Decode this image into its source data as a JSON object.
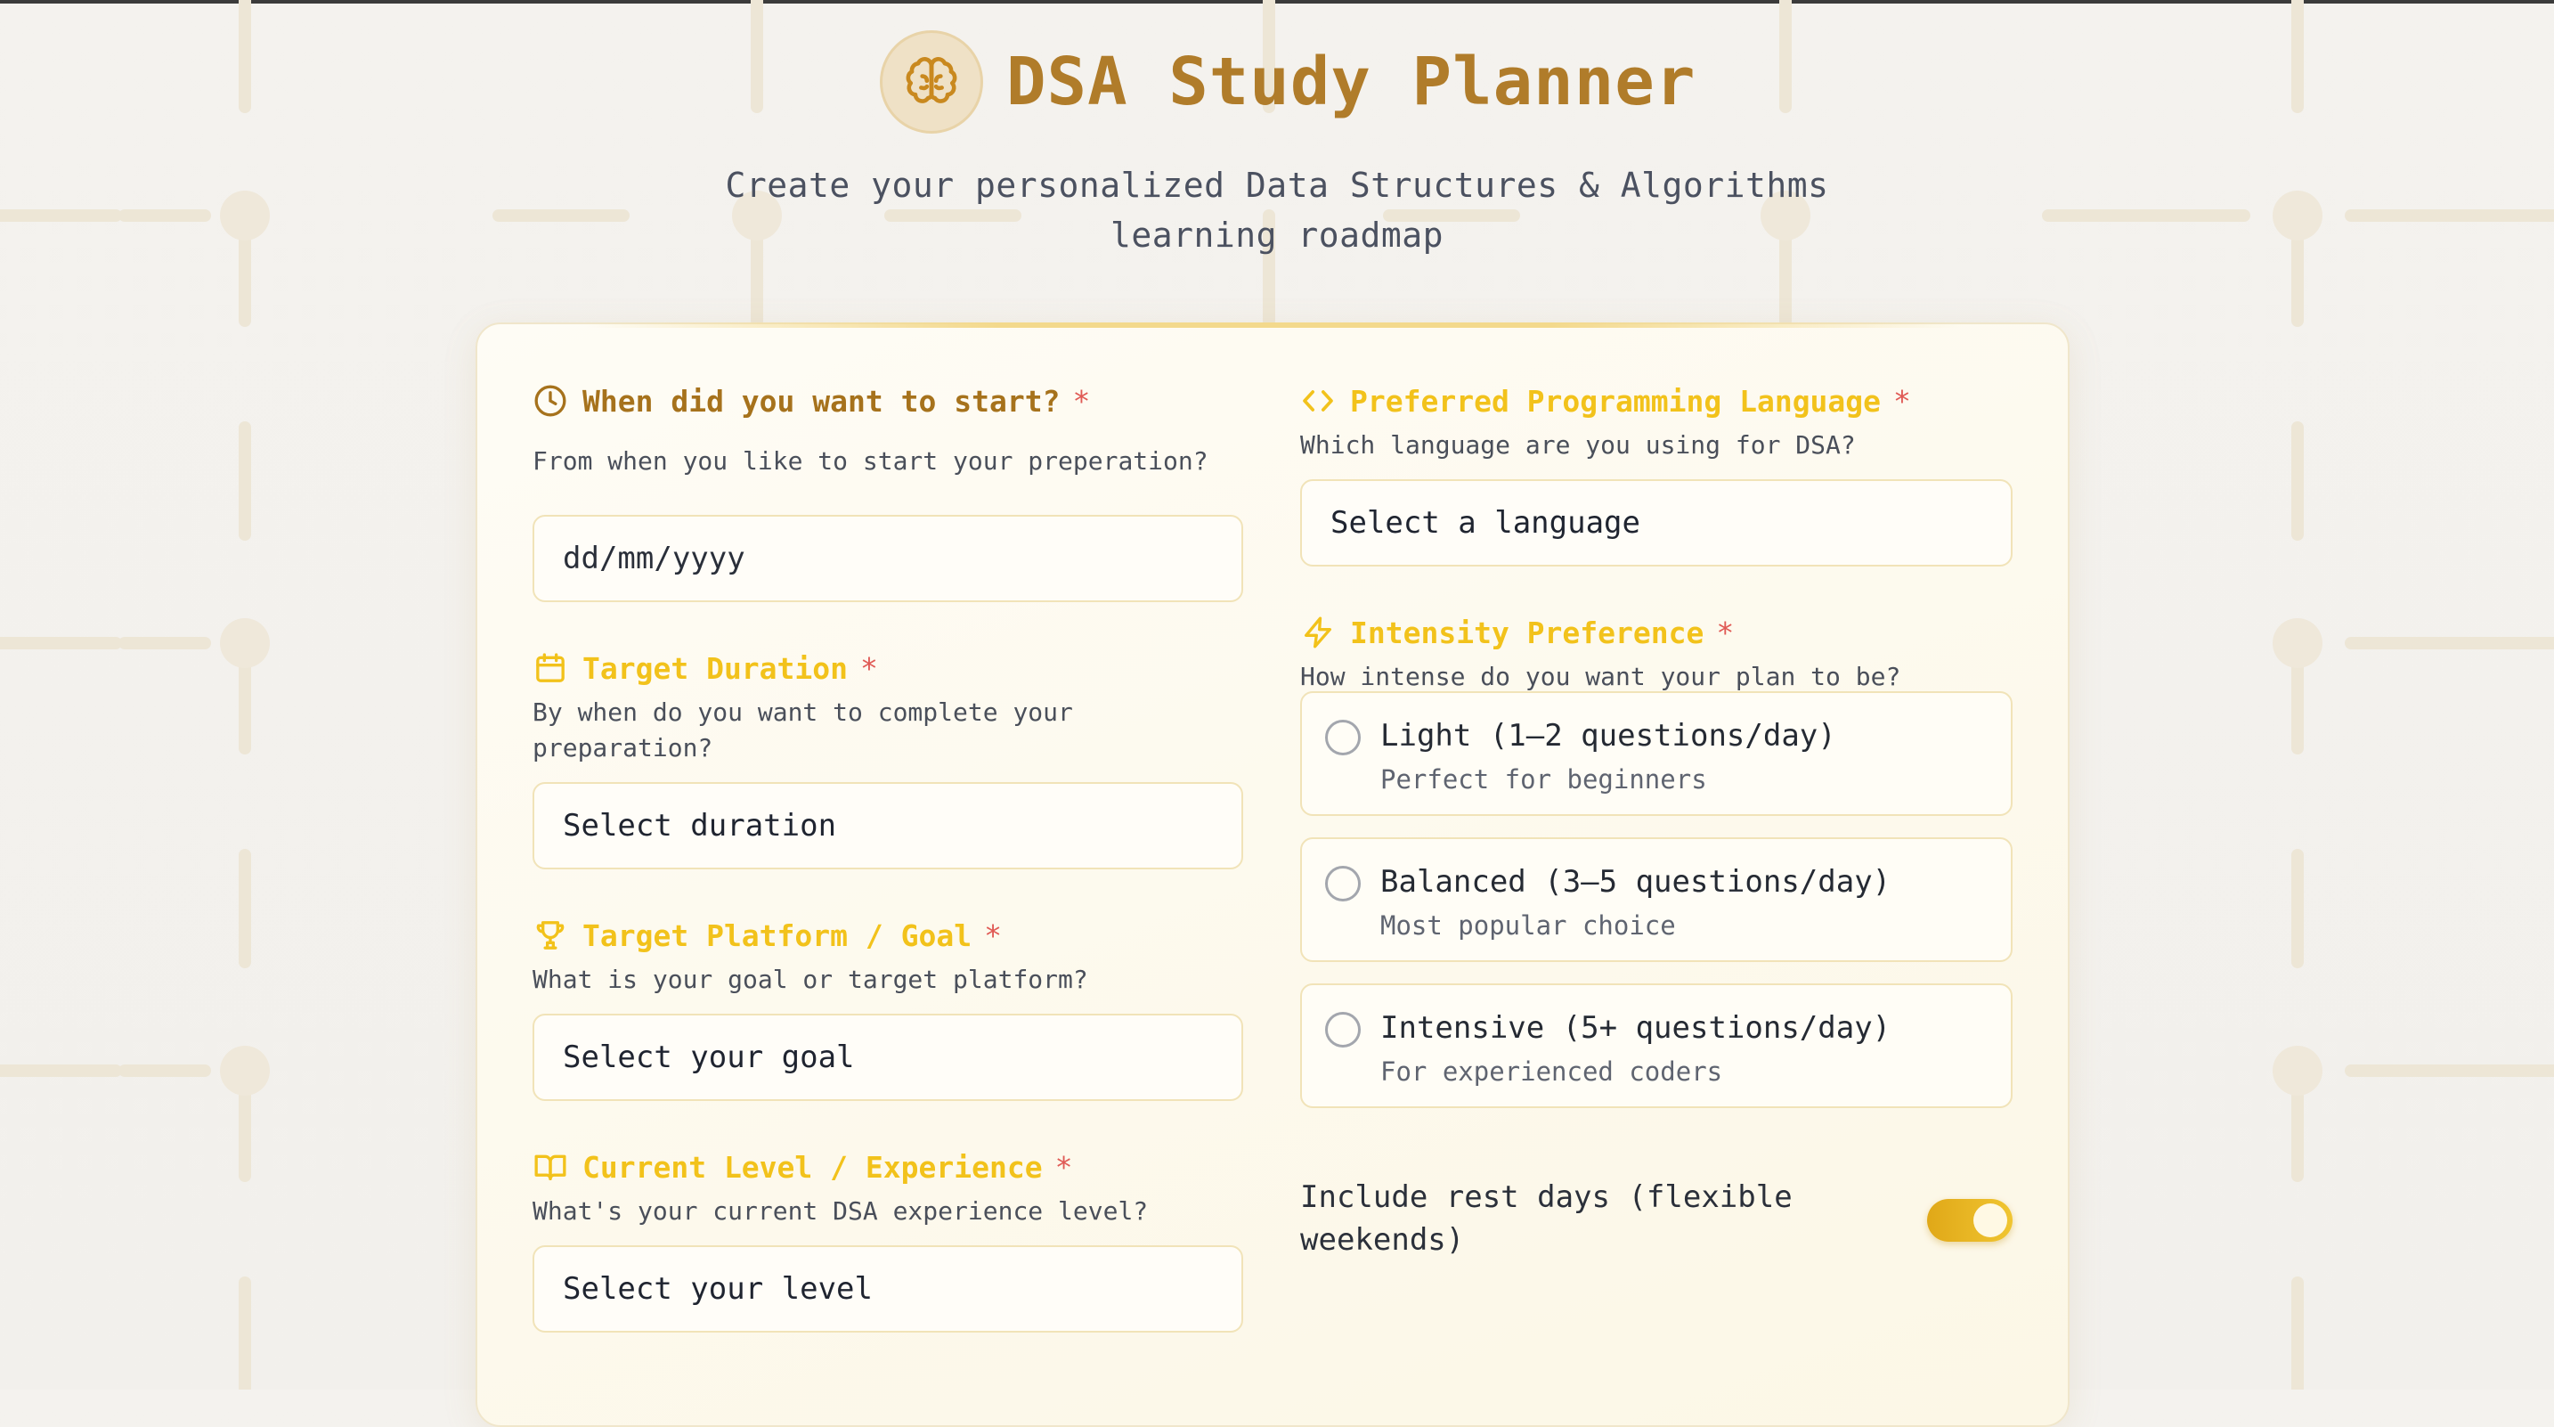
{
  "header": {
    "title": "DSA Study Planner",
    "subtitle": "Create your personalized Data Structures & Algorithms learning roadmap"
  },
  "form": {
    "start": {
      "label": "When did you want to start?",
      "required": "*",
      "help": "From when you like to start your preperation?",
      "placeholder": "dd/mm/yyyy"
    },
    "duration": {
      "label": "Target Duration",
      "required": "*",
      "help": "By when do you want to complete your preparation?",
      "value": "Select duration"
    },
    "goal": {
      "label": "Target Platform / Goal",
      "required": "*",
      "help": "What is your goal or target platform?",
      "value": "Select your goal"
    },
    "level": {
      "label": "Current Level / Experience",
      "required": "*",
      "help": "What's your current DSA experience level?",
      "value": "Select your level"
    },
    "language": {
      "label": "Preferred Programming Language",
      "required": "*",
      "help": "Which language are you using for DSA?",
      "value": "Select a language"
    },
    "intensity": {
      "label": "Intensity Preference",
      "required": "*",
      "help": "How intense do you want your plan to be?",
      "options": [
        {
          "title": "Light (1–2 questions/day)",
          "desc": "Perfect for beginners",
          "selected": false
        },
        {
          "title": "Balanced (3–5 questions/day)",
          "desc": "Most popular choice",
          "selected": false
        },
        {
          "title": "Intensive (5+ questions/day)",
          "desc": "For experienced coders",
          "selected": false
        }
      ]
    },
    "rest_days": {
      "label": "Include rest days (flexible weekends)",
      "enabled": true
    }
  },
  "colors": {
    "accent": "#f2c21b",
    "brand": "#b07c2a",
    "required": "#e05a55"
  },
  "icons": {
    "brand": "brain-icon",
    "start": "clock-icon",
    "duration": "calendar-icon",
    "goal": "trophy-icon",
    "level": "book-icon",
    "language": "code-icon",
    "intensity": "lightning-icon"
  }
}
